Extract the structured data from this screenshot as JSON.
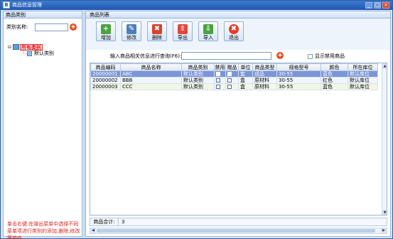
{
  "window": {
    "title": "商品信息管理",
    "app_icon": "B",
    "minimize": "_",
    "maximize": "□",
    "close": "×"
  },
  "left": {
    "panel_title": "商品类别",
    "category_label": "类别名称:",
    "category_value": "",
    "tree": {
      "root": "所有类别",
      "child": "默认类别",
      "expander": "⊟"
    },
    "hint": "单击右键,在弹出菜单中选择不同菜单项进行类别的添加,删除,修改等操作"
  },
  "right": {
    "panel_title": "商品列表",
    "toolbar": [
      {
        "label": "增加",
        "icon": "add-icon",
        "glyph": "+",
        "color": "#4aa33b"
      },
      {
        "label": "修改",
        "icon": "edit-icon",
        "glyph": "✎",
        "color": "#4f7fb8"
      },
      {
        "label": "删除",
        "icon": "delete-icon",
        "glyph": "✖",
        "color": "#d8402b"
      },
      {
        "label": "导出",
        "icon": "export-up-icon",
        "glyph": "⇧",
        "color": "#e0483a"
      },
      {
        "label": "导入",
        "icon": "import-down-icon",
        "glyph": "⇩",
        "color": "#4aa33b"
      },
      {
        "label": "退出",
        "icon": "exit-icon",
        "glyph": "✖",
        "color": "#e53b2c"
      }
    ],
    "search_label": "输入商品相关信息进行查询(F6):",
    "search_value": "",
    "show_disabled_label": "显示禁用商品",
    "columns": [
      "商品编码",
      "商品名称",
      "商品类别",
      "禁用",
      "赠品",
      "单位",
      "商品类型",
      "规格型号",
      "颜色",
      "所在库位"
    ],
    "rows": [
      [
        "20000001",
        "ABC",
        "默认类别",
        "",
        "",
        "套",
        "成品",
        "30-55",
        "蓝色",
        "默认库位"
      ],
      [
        "20000002",
        "BBB",
        "默认类别",
        "",
        "",
        "盒",
        "原材料",
        "30-55",
        "红色",
        "默认库位"
      ],
      [
        "20000003",
        "CCC",
        "默认类别",
        "",
        "",
        "盒",
        "原材料",
        "30-55",
        "蓝色",
        "默认库位"
      ]
    ],
    "footer_label": "商品合计:",
    "footer_value": "3"
  },
  "colors": {
    "selected_row": "#7b95d6",
    "hint_text": "#e0201c",
    "title_bar": "#1f57b0"
  }
}
